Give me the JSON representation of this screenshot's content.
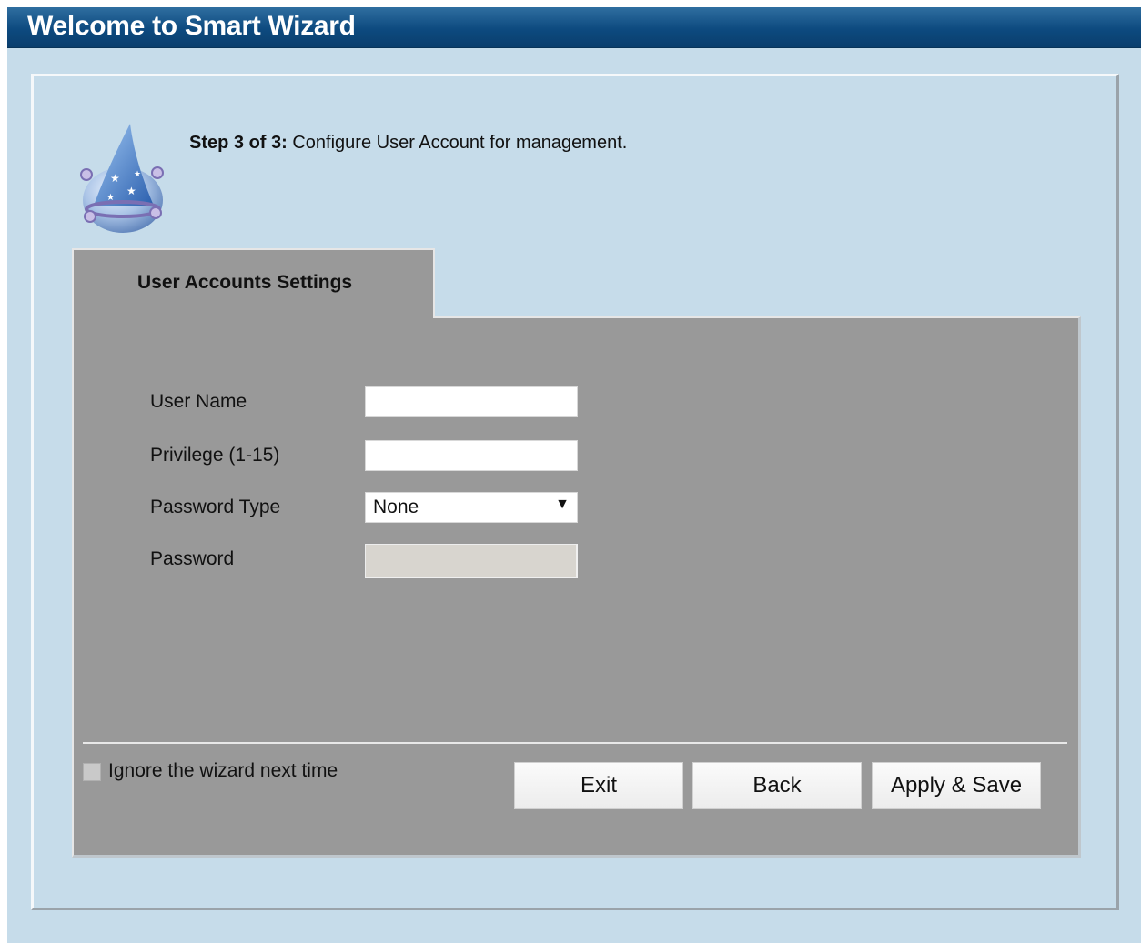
{
  "window": {
    "title": "Welcome to Smart Wizard"
  },
  "step": {
    "prefix": "Step 3 of 3:",
    "description": " Configure User Account for management."
  },
  "tab": {
    "label": "User Accounts Settings"
  },
  "form": {
    "user_name": {
      "label": "User Name",
      "value": ""
    },
    "privilege": {
      "label": "Privilege (1-15)",
      "value": ""
    },
    "password_type": {
      "label": "Password Type",
      "value": "None"
    },
    "password": {
      "label": "Password",
      "value": ""
    }
  },
  "footer": {
    "ignore_label": "Ignore the wizard next time",
    "exit_label": "Exit",
    "back_label": "Back",
    "apply_label": "Apply & Save"
  },
  "icons": {
    "wizard": "wizard-hat-icon",
    "dropdown": "triangle-down-icon"
  },
  "colors": {
    "titlebar": "#0d4a7f",
    "background": "#c6dcea",
    "panel_gray": "#999999"
  }
}
